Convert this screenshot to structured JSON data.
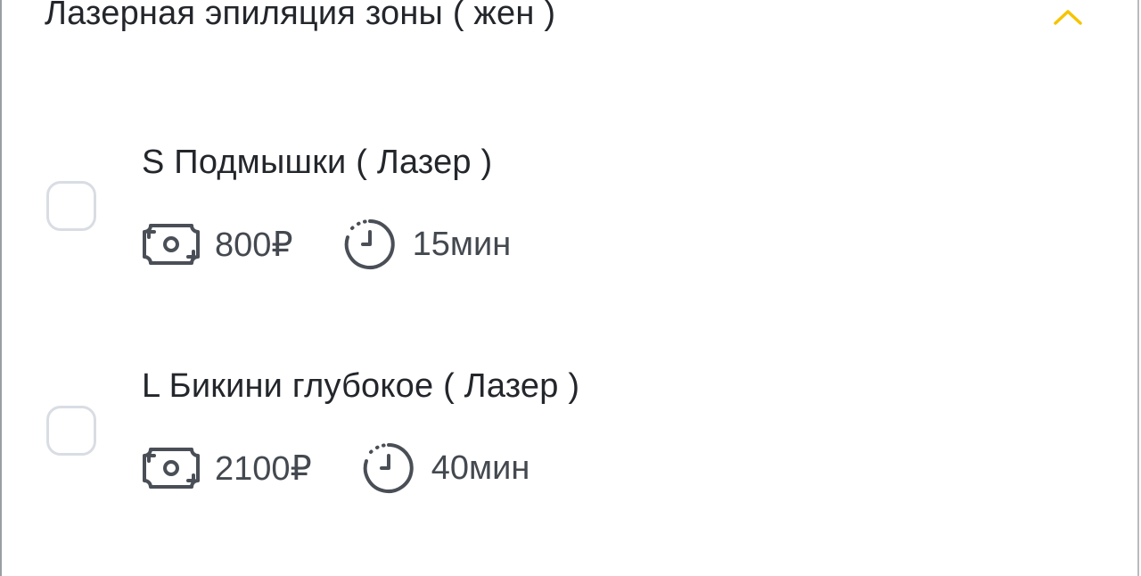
{
  "section": {
    "title": "Лазерная эпиляция зоны ( жен )",
    "toggle_icon": "chevron-up-icon",
    "accent_color": "#F5C400"
  },
  "services": [
    {
      "name": "S Подмышки ( Лазер )",
      "price": "800₽",
      "duration": "15мин",
      "checked": false
    },
    {
      "name": "L Бикини глубокое ( Лазер )",
      "price": "2100₽",
      "duration": "40мин",
      "checked": false
    }
  ],
  "icons": {
    "price": "money-icon",
    "duration": "clock-icon"
  }
}
